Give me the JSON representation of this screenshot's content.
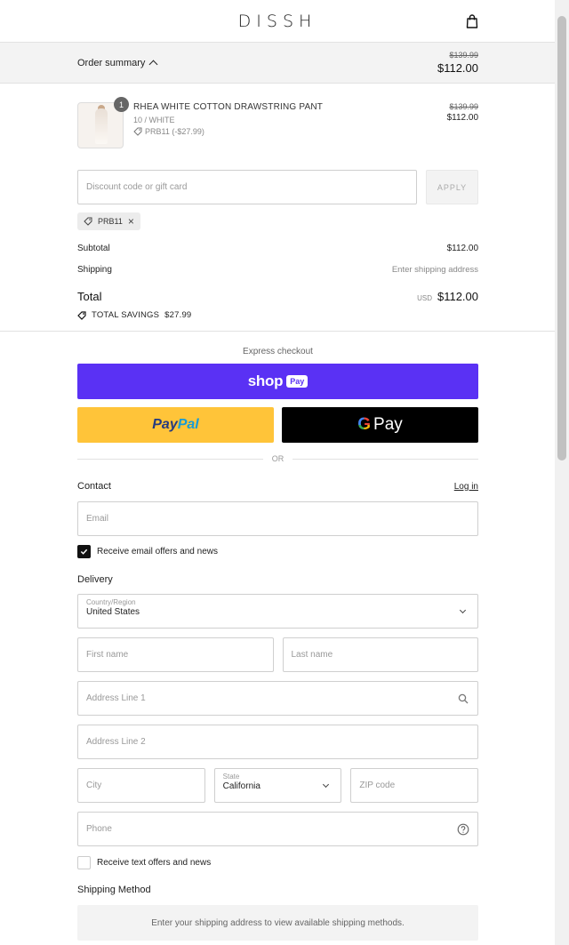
{
  "header": {
    "logo": "DISSH",
    "bag_icon": "bag-icon"
  },
  "summary_bar": {
    "label": "Order summary",
    "original_total": "$139.99",
    "total": "$112.00"
  },
  "product": {
    "quantity": "1",
    "name": "RHEA WHITE COTTON DRAWSTRING PANT",
    "variant": "10 / WHITE",
    "discount": "PRB11 (-$27.99)",
    "original_price": "$139.99",
    "price": "$112.00"
  },
  "discount": {
    "placeholder": "Discount code or gift card",
    "apply_label": "APPLY",
    "applied_code": "PRB11"
  },
  "totals": {
    "subtotal_label": "Subtotal",
    "subtotal": "$112.00",
    "shipping_label": "Shipping",
    "shipping_value": "Enter shipping address",
    "total_label": "Total",
    "currency": "USD",
    "total": "$112.00",
    "savings_label": "TOTAL SAVINGS",
    "savings": "$27.99"
  },
  "express": {
    "title": "Express checkout",
    "shop_text": "shop",
    "shop_pay": "Pay",
    "paypal_a": "Pay",
    "paypal_b": "Pal",
    "gpay_g": "G",
    "gpay_text": "Pay",
    "or": "OR"
  },
  "contact": {
    "title": "Contact",
    "login": "Log in",
    "email_placeholder": "Email",
    "offers_label": "Receive email offers and news",
    "offers_checked": true
  },
  "delivery": {
    "title": "Delivery",
    "country_label": "Country/Region",
    "country_value": "United States",
    "first_name": "First name",
    "last_name": "Last name",
    "address1": "Address Line 1",
    "address2": "Address Line 2",
    "city": "City",
    "state_label": "State",
    "state_value": "California",
    "zip": "ZIP code",
    "phone": "Phone",
    "text_offers_label": "Receive text offers and news"
  },
  "shipping_method": {
    "title": "Shipping Method",
    "message": "Enter your shipping address to view available shipping methods."
  },
  "colors": {
    "shop_pay": "#5a31f4",
    "paypal": "#ffc439",
    "gpay": "#000000"
  }
}
